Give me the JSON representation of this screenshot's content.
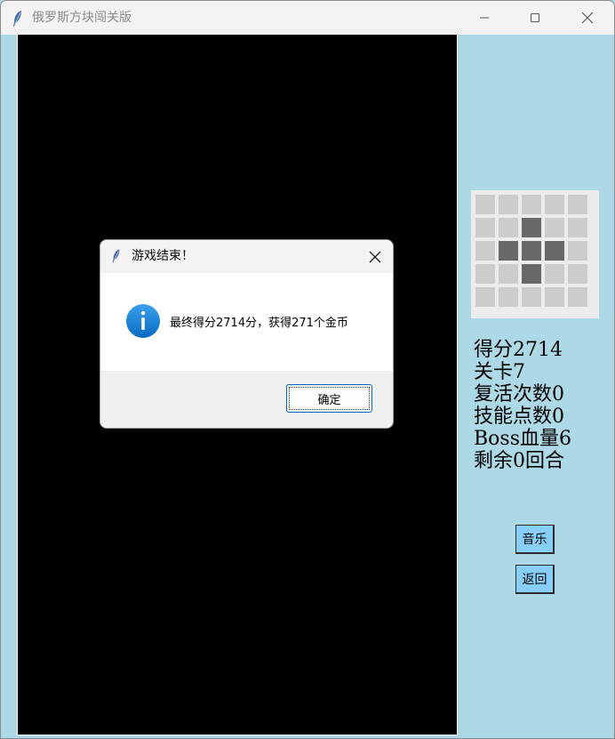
{
  "window": {
    "title": "俄罗斯方块闯关版"
  },
  "colors": {
    "background": "#add8e6",
    "board": "#000000",
    "button": "#87cefa",
    "preview_cell": "#cccccc",
    "preview_block": "#696969",
    "accent": "#0067c0"
  },
  "next_piece": {
    "grid_size": [
      5,
      5
    ],
    "filled": [
      [
        1,
        2
      ],
      [
        2,
        1
      ],
      [
        2,
        2
      ],
      [
        2,
        3
      ],
      [
        3,
        2
      ]
    ]
  },
  "stats": {
    "score": "得分2714",
    "level": "关卡7",
    "revives": "复活次数0",
    "skill_points": "技能点数0",
    "boss_hp": "Boss血量6",
    "remaining": "剩余0回合"
  },
  "buttons": {
    "music": "音乐",
    "back": "返回"
  },
  "dialog": {
    "title": "游戏结束！",
    "message": "最终得分2714分，获得271个金币",
    "ok": "确定",
    "icon": "info-icon"
  }
}
